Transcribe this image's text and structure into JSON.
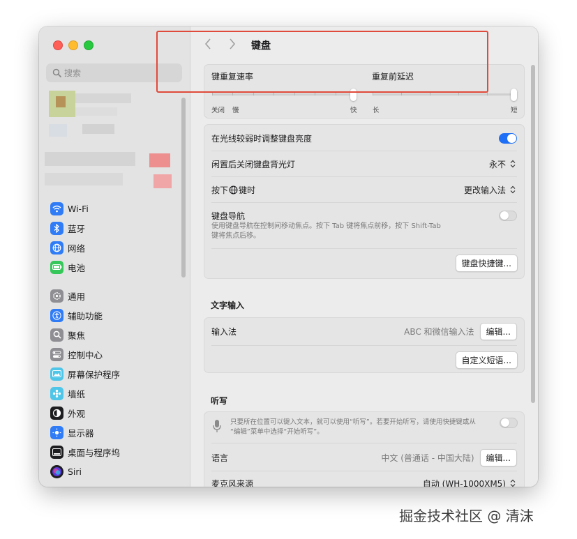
{
  "sidebar": {
    "search_placeholder": "搜索",
    "items": [
      {
        "label": "Wi-Fi",
        "icon": "wifi-icon",
        "color": "#2f7cf6"
      },
      {
        "label": "蓝牙",
        "icon": "bluetooth-icon",
        "color": "#2f7cf6"
      },
      {
        "label": "网络",
        "icon": "globe-icon",
        "color": "#2f7cf6"
      },
      {
        "label": "电池",
        "icon": "battery-icon",
        "color": "#35c759"
      },
      {
        "label": "通用",
        "icon": "gear-icon",
        "color": "#8e8e93"
      },
      {
        "label": "辅助功能",
        "icon": "accessibility-icon",
        "color": "#2f7cf6"
      },
      {
        "label": "聚焦",
        "icon": "magnifier-icon",
        "color": "#8e8e93"
      },
      {
        "label": "控制中心",
        "icon": "control-center-icon",
        "color": "#8e8e93"
      },
      {
        "label": "屏幕保护程序",
        "icon": "screensaver-icon",
        "color": "#4fc6e8"
      },
      {
        "label": "墙纸",
        "icon": "wallpaper-icon",
        "color": "#4fc6e8"
      },
      {
        "label": "外观",
        "icon": "appearance-icon",
        "color": "#1d1d1f"
      },
      {
        "label": "显示器",
        "icon": "display-icon",
        "color": "#2f7cf6"
      },
      {
        "label": "桌面与程序坞",
        "icon": "dock-icon",
        "color": "#1d1d1f"
      },
      {
        "label": "Siri",
        "icon": "siri-icon",
        "color": "#6a4cf0"
      }
    ]
  },
  "header": {
    "title": "键盘"
  },
  "repeat": {
    "rate_label": "键重复速率",
    "delay_label": "重复前延迟",
    "rate_left": "关闭",
    "rate_slow": "慢",
    "rate_fast": "快",
    "delay_long": "长",
    "delay_short": "短",
    "rate_value": 1.0,
    "delay_value": 1.0
  },
  "settings": {
    "brightness_label": "在光线较弱时调整键盘亮度",
    "brightness_on": true,
    "backlight_label": "闲置后关闭键盘背光灯",
    "backlight_value": "永不",
    "press_label_a": "按下",
    "press_label_b": "键时",
    "press_value": "更改输入法",
    "nav_label": "键盘导航",
    "nav_desc_1": "使用键盘导航在控制间移动焦点。按下 Tab 键将焦点前移，按下 Shift-Tab",
    "nav_desc_2": "键将焦点后移。",
    "nav_on": false,
    "shortcuts_button": "键盘快捷键..."
  },
  "text_input": {
    "section_title": "文字输入",
    "input_label": "输入法",
    "input_value": "ABC 和微信输入法",
    "edit_button": "编辑...",
    "custom_button": "自定义短语..."
  },
  "dictation": {
    "section_title": "听写",
    "desc_1": "只要所在位置可以键入文本，就可以使用“听写”。若要开始听写，请使用快捷键或从",
    "desc_2": "“编辑”菜单中选择“开始听写”。",
    "dictation_on": false,
    "language_label": "语言",
    "language_value": "中文 (普通话 - 中国大陆)",
    "edit_button": "编辑...",
    "mic_label": "麦克风来源",
    "mic_value": "自动 (WH-1000XM5)"
  },
  "watermark": "掘金技术社区 @ 清沫",
  "colors": {
    "accent": "#1e6ff5",
    "highlight": "#e04a3a"
  }
}
